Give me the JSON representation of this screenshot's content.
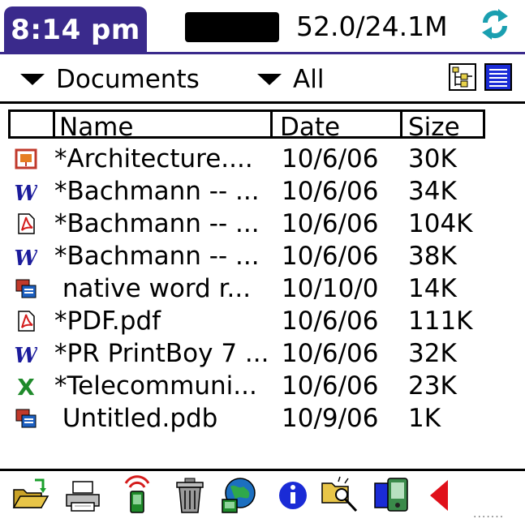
{
  "status": {
    "time": "8:14 pm",
    "memory": "52.0/24.1M",
    "sync_icon": "sync-icon"
  },
  "filters": {
    "category": "Documents",
    "type": "All"
  },
  "view_toggle": {
    "tree_icon": "tree-view-icon",
    "list_icon": "list-view-icon"
  },
  "table": {
    "columns": {
      "name": "Name",
      "date": "Date",
      "size": "Size"
    },
    "rows": [
      {
        "icon": "powerpoint-icon",
        "name": "*Architecture....",
        "date": "10/6/06",
        "size": "30K"
      },
      {
        "icon": "word-icon",
        "name": "*Bachmann -- ...",
        "date": "10/6/06",
        "size": "34K"
      },
      {
        "icon": "pdf-icon",
        "name": "*Bachmann -- ...",
        "date": "10/6/06",
        "size": "104K"
      },
      {
        "icon": "word-icon",
        "name": "*Bachmann -- ...",
        "date": "10/6/06",
        "size": "38K"
      },
      {
        "icon": "database-icon",
        "name": " native word r...",
        "date": "10/10/0",
        "size": "14K"
      },
      {
        "icon": "pdf-icon",
        "name": "*PDF.pdf",
        "date": "10/6/06",
        "size": "111K"
      },
      {
        "icon": "word-icon",
        "name": "*PR PrintBoy 7 ...",
        "date": "10/6/06",
        "size": "32K"
      },
      {
        "icon": "excel-icon",
        "name": "*Telecommuni...",
        "date": "10/6/06",
        "size": "23K"
      },
      {
        "icon": "database-icon",
        "name": " Untitled.pdb",
        "date": "10/9/06",
        "size": "1K"
      }
    ]
  },
  "toolbar": [
    "open-folder-icon",
    "printer-icon",
    "beam-icon",
    "trash-icon",
    "web-icon",
    "info-icon",
    "find-folder-icon",
    "device-copy-icon",
    "back-arrow-icon"
  ],
  "colors": {
    "title_bar": "#3a2a8c",
    "word": "#1c1c9c",
    "pdf": "#d41c1c",
    "excel": "#1f8a2b",
    "list_view": "#1a2bd6"
  }
}
